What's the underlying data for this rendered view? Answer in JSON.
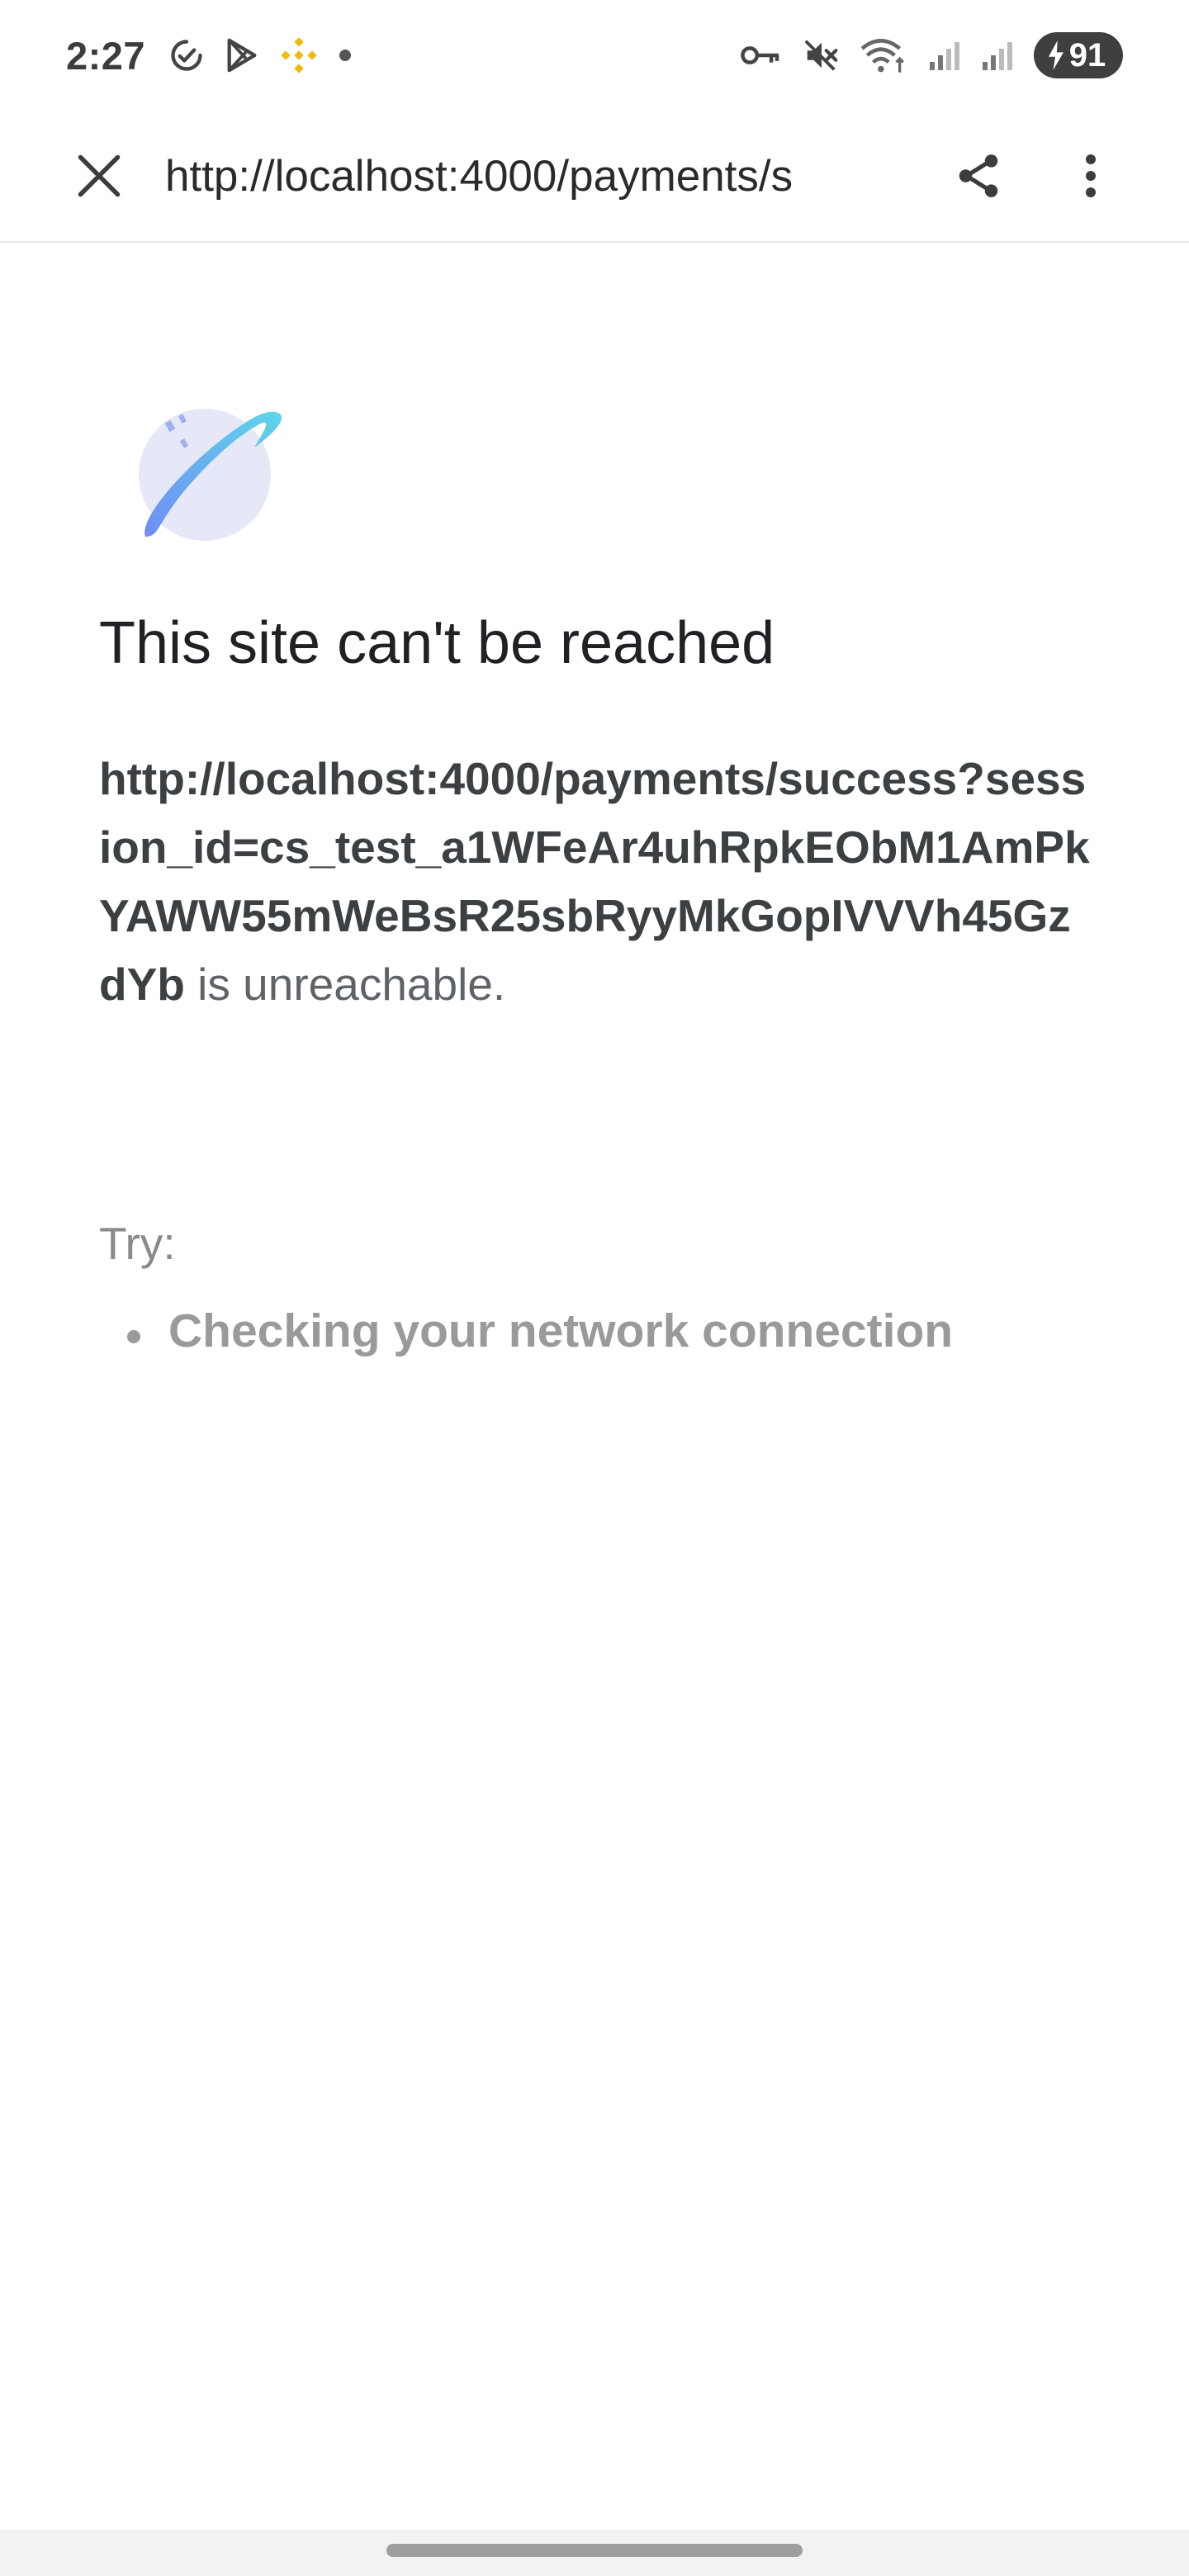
{
  "status_bar": {
    "time": "2:27",
    "battery_level": "91",
    "left_icons": [
      "check-circle-icon",
      "play-store-icon",
      "binance-icon",
      "dot-icon"
    ],
    "right_icons": [
      "vpn-key-icon",
      "mute-icon",
      "wifi-icon",
      "signal-icon",
      "signal-icon",
      "battery-charging-icon"
    ],
    "colors": {
      "binance": "#F0B90B"
    }
  },
  "toolbar": {
    "url": "http://localhost:4000/payments/s",
    "icons": [
      "close-icon",
      "share-icon",
      "more-vert-icon"
    ]
  },
  "error_page": {
    "title": "This site can't be reached",
    "url_bold": "http://localhost:4000/payments/success?session_id=cs_test_a1WFeAr4uhRpkEObM1AmPkYAWW55mWeBsR25sbRyyMkGopIVVVh45GzdYb",
    "url_suffix": " is unreachable.",
    "try_label": "Try:",
    "suggestions": [
      "Checking your network connection"
    ],
    "illustration_icon": "planet-illustration-icon"
  }
}
